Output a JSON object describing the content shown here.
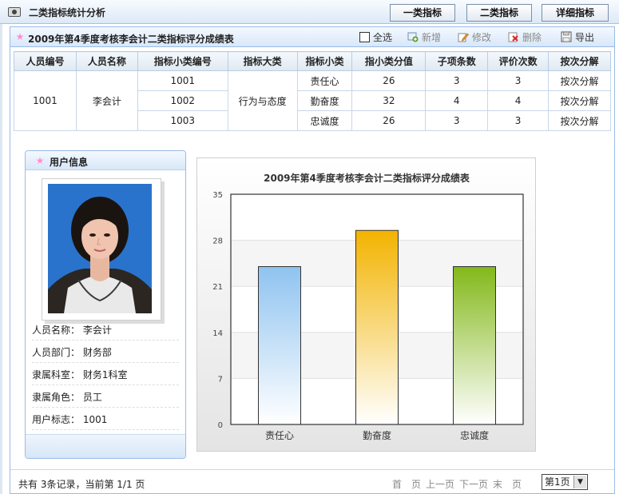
{
  "app": {
    "title": "二类指标统计分析",
    "tabs": [
      {
        "label": "一类指标"
      },
      {
        "label": "二类指标"
      },
      {
        "label": "详细指标"
      }
    ]
  },
  "panel": {
    "title": "2009年第4季度考核李会计二类指标评分成绩表",
    "toolbar": {
      "select_all": "全选",
      "add": "新增",
      "edit": "修改",
      "delete": "删除",
      "export": "导出"
    }
  },
  "table": {
    "headers": [
      "人员编号",
      "人员名称",
      "指标小类编号",
      "指标大类",
      "指标小类",
      "指小类分值",
      "子项条数",
      "评价次数",
      "按次分解"
    ],
    "person_id": "1001",
    "person_name": "李会计",
    "category": "行为与态度",
    "rows": [
      {
        "code": "1001",
        "sub": "责任心",
        "score": "26",
        "items": "3",
        "times": "3",
        "action": "按次分解"
      },
      {
        "code": "1002",
        "sub": "勤奋度",
        "score": "32",
        "items": "4",
        "times": "4",
        "action": "按次分解"
      },
      {
        "code": "1003",
        "sub": "忠诚度",
        "score": "26",
        "items": "3",
        "times": "3",
        "action": "按次分解"
      }
    ]
  },
  "user_card": {
    "title": "用户信息",
    "name_line": "人员名称： 李会计",
    "dept_line": "人员部门： 财务部",
    "office_line": "隶属科室： 财务1科室",
    "role_line": "隶属角色： 员工",
    "flag_line": "用户标志： 1001"
  },
  "chart_data": {
    "type": "bar",
    "title": "2009年第4季度考核李会计二类指标评分成绩表",
    "categories": [
      "责任心",
      "勤奋度",
      "忠诚度"
    ],
    "values": [
      24,
      29.5,
      24
    ],
    "ylim": [
      0,
      35
    ],
    "yticks": [
      0,
      7,
      14,
      21,
      28,
      35
    ],
    "grid": true,
    "colors": [
      "#8fc3f0",
      "#f2b300",
      "#83b81a"
    ]
  },
  "footer": {
    "summary": "共有 3条记录，当前第 1/1 页",
    "first": "首　页",
    "prev": "上一页",
    "next": "下一页",
    "last": "末　页",
    "page_select": "第1页"
  }
}
